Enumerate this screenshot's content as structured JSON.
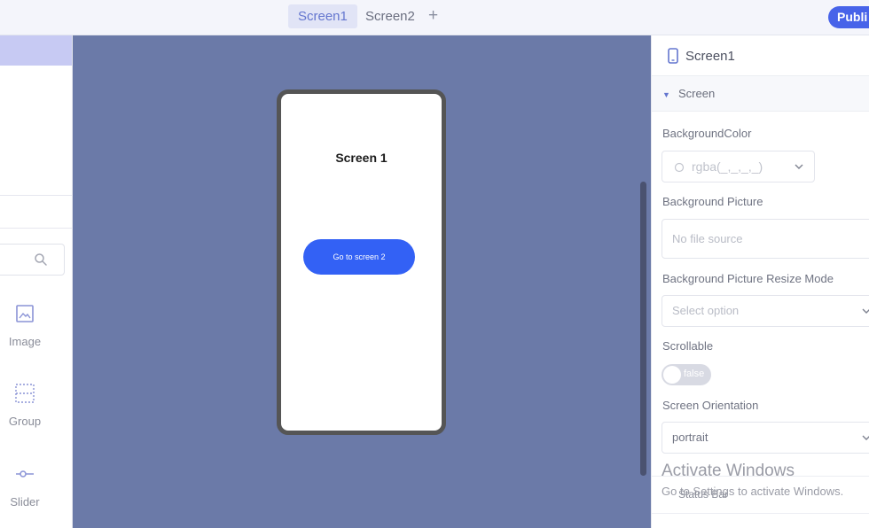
{
  "topbar": {
    "tabs": [
      {
        "label": "Screen1",
        "active": true
      },
      {
        "label": "Screen2",
        "active": false
      }
    ],
    "add_tab_label": "+",
    "publish_label": "Publi"
  },
  "left_panel": {
    "search": {
      "placeholder": "",
      "icon": "search-icon"
    },
    "widgets": [
      {
        "label": "Image",
        "icon": "image-icon"
      },
      {
        "label": "Group",
        "icon": "group-icon"
      },
      {
        "label": "Slider",
        "icon": "slider-icon"
      }
    ]
  },
  "canvas": {
    "screen_title": "Screen 1",
    "button_label": "Go to screen 2",
    "background_color": "#6b7aa8",
    "button_color": "#3361f5"
  },
  "right_panel": {
    "title": "Screen1",
    "section_label": "Screen",
    "properties": {
      "background_color": {
        "label": "BackgroundColor",
        "value": "rgba(_,_,_,_)"
      },
      "background_picture": {
        "label": "Background Picture",
        "placeholder": "No file source"
      },
      "resize_mode": {
        "label": "Background Picture Resize Mode",
        "placeholder": "Select option"
      },
      "scrollable": {
        "label": "Scrollable",
        "value": "false"
      },
      "orientation": {
        "label": "Screen Orientation",
        "value": "portrait"
      }
    },
    "bottom_section_label": "Status Bar"
  },
  "watermark": {
    "line1": "Activate Windows",
    "line2": "Go to Settings to activate Windows."
  },
  "colors": {
    "accent": "#4763e9",
    "canvas": "#6b7aa8",
    "sidebar_highlight": "#c7caf3"
  }
}
